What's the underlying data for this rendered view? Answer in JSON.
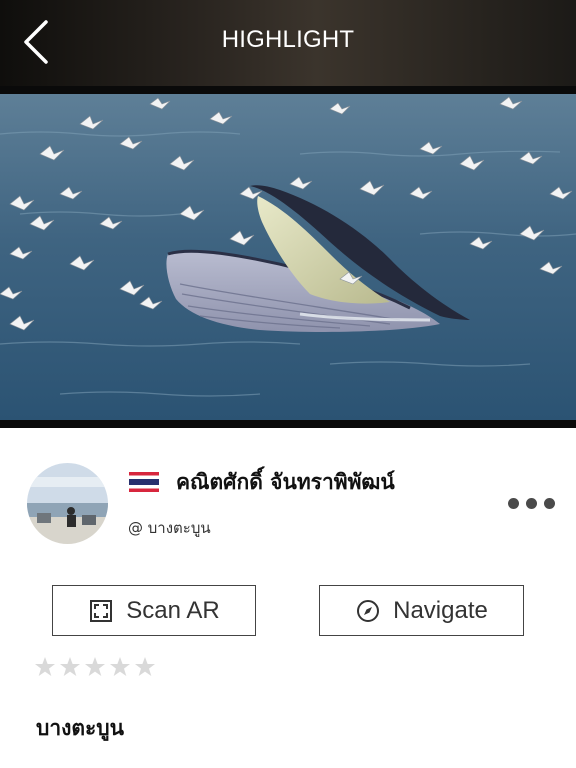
{
  "header": {
    "title": "HIGHLIGHT",
    "back_icon": "chevron-left-icon"
  },
  "hero": {
    "description": "whale-feeding-with-seagulls-photo"
  },
  "author": {
    "name": "คณิตศักดิ์ จันทราพิพัฒน์",
    "location": "@ บางตะบูน",
    "flag_icon": "thailand-flag-icon",
    "more_icon": "more-dots-icon"
  },
  "actions": {
    "scan_label": "Scan AR",
    "scan_icon": "scan-frame-icon",
    "navigate_label": "Navigate",
    "navigate_icon": "compass-icon"
  },
  "rating": {
    "value": 0,
    "max": 5
  },
  "place": {
    "title": "บางตะบูน"
  },
  "colors": {
    "header_bg": "#1f1c19",
    "button_border": "#444444",
    "star_empty": "#d9d9d9",
    "flag_red": "#d7263d",
    "flag_blue": "#27306e"
  }
}
